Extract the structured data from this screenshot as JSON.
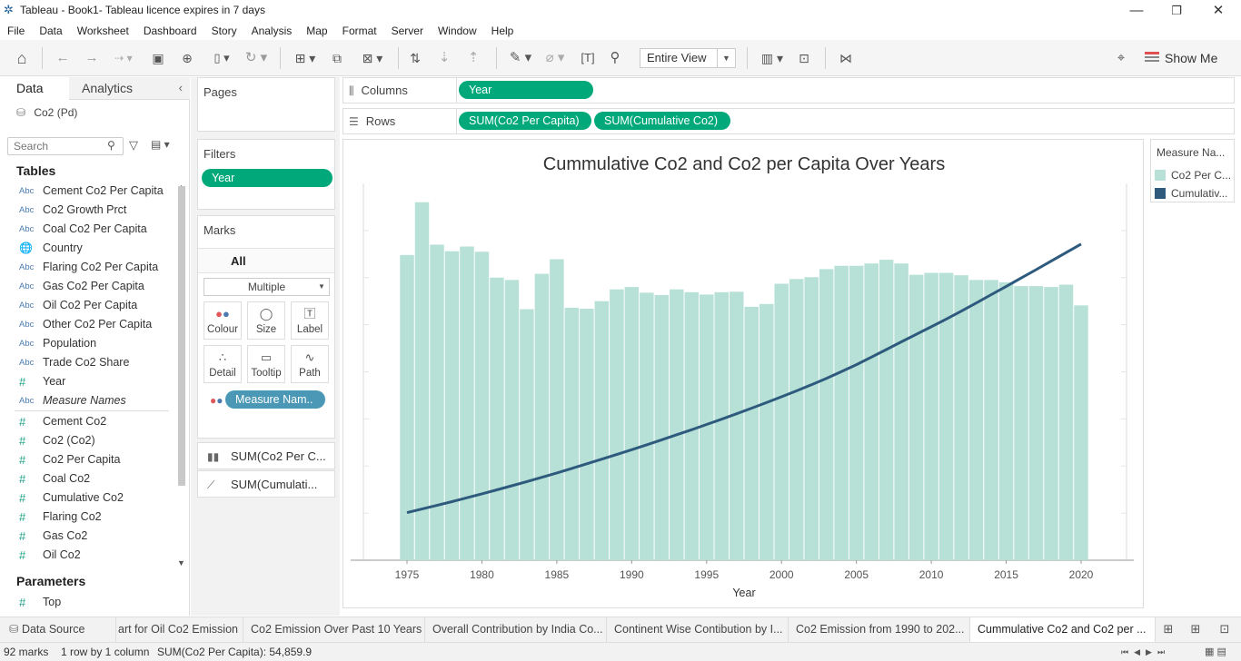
{
  "window": {
    "title": "Tableau - Book1- Tableau licence expires in 7 days",
    "minimize": "—",
    "restore": "❐",
    "close": "✕"
  },
  "menu": [
    "File",
    "Data",
    "Worksheet",
    "Dashboard",
    "Story",
    "Analysis",
    "Map",
    "Format",
    "Server",
    "Window",
    "Help"
  ],
  "toolbar": {
    "fit_value": "Entire View",
    "show_me": "Show Me"
  },
  "data_pane": {
    "tab_data": "Data",
    "tab_analytics": "Analytics",
    "collapse": "‹",
    "data_source": "Co2 (Pd)",
    "search_placeholder": "Search",
    "tables_heading": "Tables",
    "dimensions": [
      {
        "type": "Abc",
        "name": "Cement Co2 Per Capita"
      },
      {
        "type": "Abc",
        "name": "Co2 Growth Prct"
      },
      {
        "type": "Abc",
        "name": "Coal Co2 Per Capita"
      },
      {
        "type": "geo",
        "name": "Country"
      },
      {
        "type": "Abc",
        "name": "Flaring Co2 Per Capita"
      },
      {
        "type": "Abc",
        "name": "Gas Co2 Per Capita"
      },
      {
        "type": "Abc",
        "name": "Oil Co2 Per Capita"
      },
      {
        "type": "Abc",
        "name": "Other Co2 Per Capita"
      },
      {
        "type": "Abc",
        "name": "Population"
      },
      {
        "type": "Abc",
        "name": "Trade Co2 Share"
      },
      {
        "type": "#",
        "name": "Year"
      },
      {
        "type": "Abc",
        "name": "Measure Names",
        "italic": true
      }
    ],
    "measures": [
      {
        "type": "#",
        "name": "Cement Co2"
      },
      {
        "type": "#",
        "name": "Co2 (Co2)"
      },
      {
        "type": "#",
        "name": "Co2 Per Capita"
      },
      {
        "type": "#",
        "name": "Coal Co2"
      },
      {
        "type": "#",
        "name": "Cumulative Co2"
      },
      {
        "type": "#",
        "name": "Flaring Co2"
      },
      {
        "type": "#",
        "name": "Gas Co2"
      },
      {
        "type": "#",
        "name": "Oil Co2"
      }
    ],
    "parameters_heading": "Parameters",
    "parameters": [
      {
        "type": "#",
        "name": "Top"
      }
    ]
  },
  "cards": {
    "pages": "Pages",
    "filters": "Filters",
    "filter_pill": "Year",
    "marks": "Marks",
    "marks_all": "All",
    "mark_type": "Multiple",
    "mark_buttons": {
      "colour": "Colour",
      "size": "Size",
      "label": "Label",
      "detail": "Detail",
      "tooltip": "Tooltip",
      "path": "Path"
    },
    "measure_names_pill": "Measure Nam..",
    "mark_sections": [
      "SUM(Co2 Per C...",
      "SUM(Cumulati..."
    ]
  },
  "shelves": {
    "columns_label": "Columns",
    "columns_pills": [
      "Year"
    ],
    "rows_label": "Rows",
    "rows_pills": [
      "SUM(Co2 Per Capita)",
      "SUM(Cumulative Co2)"
    ]
  },
  "legend": {
    "title": "Measure Na...",
    "items": [
      {
        "label": "Co2 Per C...",
        "color": "#b7e1d6"
      },
      {
        "label": "Cumulativ...",
        "color": "#2e5a7e"
      }
    ]
  },
  "chart_data": {
    "type": "bar",
    "title": "Cummulative Co2 and Co2 per Capita Over Years",
    "xlabel": "Year",
    "x_ticks": [
      "1975",
      "1980",
      "1985",
      "1990",
      "1995",
      "2000",
      "2005",
      "2010",
      "2015",
      "2020"
    ],
    "x": [
      1975,
      1976,
      1977,
      1978,
      1979,
      1980,
      1981,
      1982,
      1983,
      1984,
      1985,
      1986,
      1987,
      1988,
      1989,
      1990,
      1991,
      1992,
      1993,
      1994,
      1995,
      1996,
      1997,
      1998,
      1999,
      2000,
      2001,
      2002,
      2003,
      2004,
      2005,
      2006,
      2007,
      2008,
      2009,
      2010,
      2011,
      2012,
      2013,
      2014,
      2015,
      2016,
      2017,
      2018,
      2019,
      2020
    ],
    "bar_color": "#b7e1d6",
    "line_color": "#2e5a7e",
    "series": [
      {
        "name": "Co2 Per Capita",
        "mark": "bar",
        "values": [
          1296,
          1520,
          1340,
          1312,
          1332,
          1310,
          1200,
          1190,
          1066,
          1216,
          1278,
          1072,
          1068,
          1100,
          1150,
          1160,
          1136,
          1126,
          1150,
          1138,
          1128,
          1138,
          1140,
          1076,
          1088,
          1174,
          1194,
          1202,
          1236,
          1250,
          1250,
          1260,
          1276,
          1260,
          1212,
          1220,
          1220,
          1210,
          1190,
          1190,
          1180,
          1164,
          1164,
          1160,
          1170,
          1082
        ]
      },
      {
        "name": "Cumulative Co2",
        "mark": "line",
        "values": [
          480,
          516,
          553,
          591,
          630,
          669,
          710,
          751,
          793,
          836,
          880,
          926,
          972,
          1019,
          1066,
          1114,
          1164,
          1214,
          1265,
          1316,
          1369,
          1422,
          1477,
          1533,
          1590,
          1648,
          1708,
          1770,
          1834,
          1902,
          1972,
          2048,
          2124,
          2202,
          2278,
          2354,
          2432,
          2512,
          2594,
          2678,
          2762,
          2846,
          2930,
          3016,
          3102,
          3188
        ]
      }
    ],
    "left_axis_max": 1600,
    "right_axis_max": 3800
  },
  "sheet_tabs": {
    "data_source": "Data Source",
    "tabs": [
      "art for Oil Co2 Emission",
      "Co2 Emission Over Past 10 Years",
      "Overall Contribution by India Co...",
      "Continent Wise Contibution by I...",
      "Co2 Emission from 1990 to 202...",
      "Cummulative Co2 and Co2 per ..."
    ]
  },
  "status": {
    "marks": "92 marks",
    "rows_cols": "1 row by 1 column",
    "sum": "SUM(Co2 Per Capita): 54,859.9"
  }
}
